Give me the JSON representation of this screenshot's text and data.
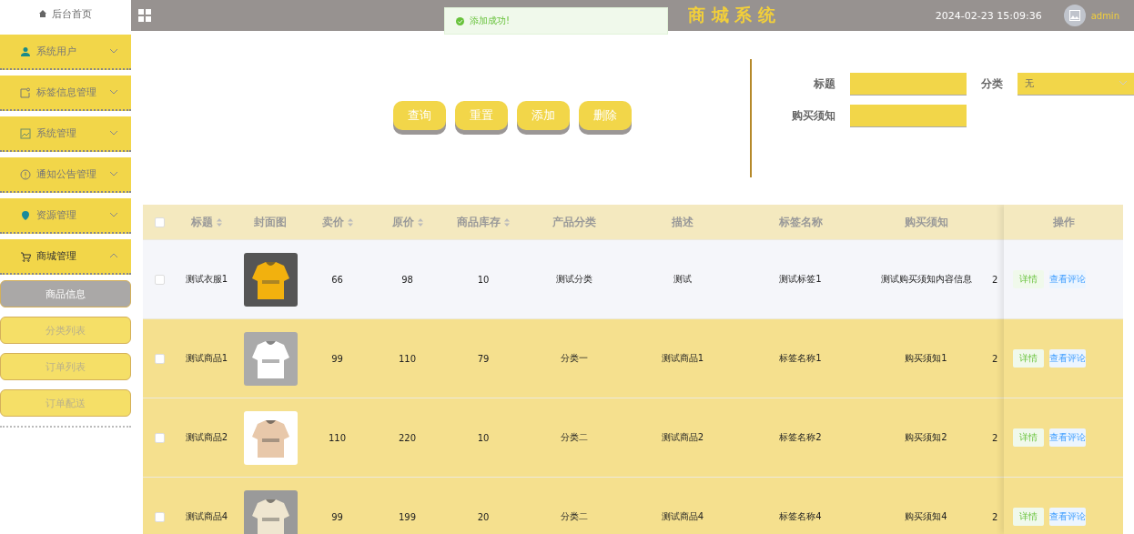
{
  "sidebar": {
    "home": {
      "label": "后台首页"
    },
    "menus": [
      {
        "label": "系统用户",
        "expanded": false
      },
      {
        "label": "标签信息管理",
        "expanded": false
      },
      {
        "label": "系统管理",
        "expanded": false
      },
      {
        "label": "通知公告管理",
        "expanded": false
      },
      {
        "label": "资源管理",
        "expanded": false
      },
      {
        "label": "商城管理",
        "expanded": true,
        "children": [
          {
            "label": "商品信息",
            "selected": true
          },
          {
            "label": "分类列表",
            "selected": false
          },
          {
            "label": "订单列表",
            "selected": false
          },
          {
            "label": "订单配送",
            "selected": false
          }
        ]
      }
    ]
  },
  "topbar": {
    "title": "商 城 系 统",
    "datetime": "2024-02-23 15:09:36",
    "user": "admin"
  },
  "toast": {
    "message": "添加成功!"
  },
  "actions": [
    "查询",
    "重置",
    "添加",
    "删除"
  ],
  "filters": [
    {
      "kind": "text",
      "label": "标题"
    },
    {
      "kind": "select",
      "label": "分类",
      "value": "无"
    },
    {
      "kind": "text",
      "label": "购买须知"
    }
  ],
  "table": {
    "all_checked": false,
    "columns": [
      {
        "label": "标题",
        "sortable": true
      },
      {
        "label": "封面图",
        "sortable": false
      },
      {
        "label": "卖价",
        "sortable": true
      },
      {
        "label": "原价",
        "sortable": true
      },
      {
        "label": "商品库存",
        "sortable": true
      },
      {
        "label": "产品分类",
        "sortable": false
      },
      {
        "label": "描述",
        "sortable": false
      },
      {
        "label": "标签名称",
        "sortable": false
      },
      {
        "label": "购买须知",
        "sortable": false
      }
    ],
    "action_column": "操作",
    "rows": [
      {
        "checked": false,
        "title": "测试衣服1",
        "cover": {
          "kind": "picture"
        },
        "price": "66",
        "original": "98",
        "stock": "10",
        "category": "测试分类",
        "desc": "测试",
        "tag": "测试标签1",
        "notice": "测试购买须知内容信息",
        "column_10": "2",
        "buttons": [
          "详情",
          "查看评论"
        ]
      },
      {
        "checked": false,
        "title": "测试商品1",
        "cover": {
          "kind": "picture"
        },
        "price": "99",
        "original": "110",
        "stock": "79",
        "category": "分类一",
        "desc": "测试商品1",
        "tag": "标签名称1",
        "notice": "购买须知1",
        "column_10": "2",
        "buttons": [
          "详情",
          "查看评论"
        ]
      },
      {
        "checked": false,
        "title": "测试商品2",
        "cover": {
          "kind": "picture"
        },
        "price": "110",
        "original": "220",
        "stock": "10",
        "category": "分类二",
        "desc": "测试商品2",
        "tag": "标签名称2",
        "notice": "购买须知2",
        "column_10": "2",
        "buttons": [
          "详情",
          "查看评论"
        ]
      },
      {
        "checked": false,
        "title": "测试商品4",
        "cover": {
          "kind": "picture"
        },
        "price": "99",
        "original": "199",
        "stock": "20",
        "category": "分类二",
        "desc": "测试商品4",
        "tag": "标签名称4",
        "notice": "购买须知4",
        "column_10": "2",
        "buttons": [
          "详情",
          "查看评论"
        ]
      }
    ]
  }
}
